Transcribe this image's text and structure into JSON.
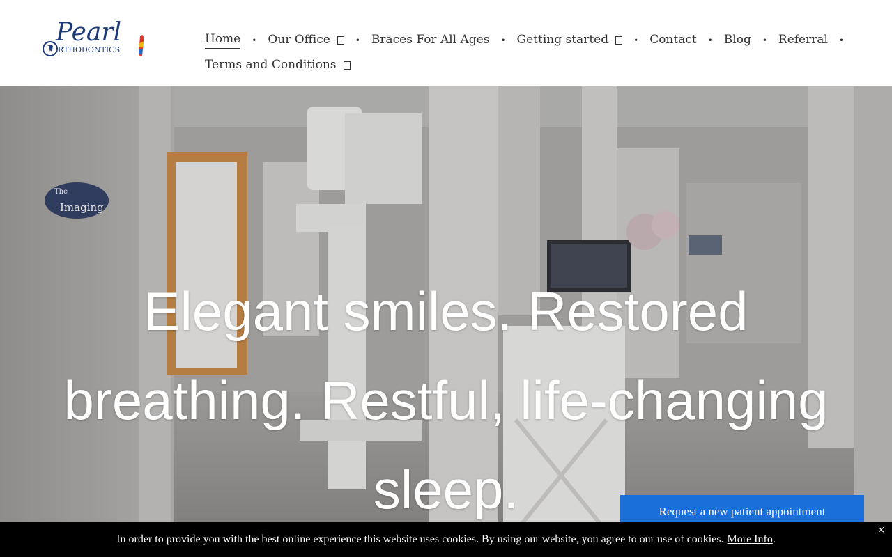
{
  "brand": {
    "logo_script": "Pearl",
    "logo_sub": "RTHODONTICS"
  },
  "nav": {
    "row1": [
      {
        "label": "Home",
        "active": true,
        "dropdown": false
      },
      {
        "label": "Our Office",
        "active": false,
        "dropdown": true
      },
      {
        "label": "Braces For All Ages",
        "active": false,
        "dropdown": false
      },
      {
        "label": "Getting started",
        "active": false,
        "dropdown": true
      },
      {
        "label": "Contact",
        "active": false,
        "dropdown": false
      },
      {
        "label": "Blog",
        "active": false,
        "dropdown": false
      },
      {
        "label": "Referral",
        "active": false,
        "dropdown": false
      }
    ],
    "row2": [
      {
        "label": "Terms and Conditions",
        "active": false,
        "dropdown": true
      }
    ],
    "separator": "•"
  },
  "hero": {
    "title": "Elegant smiles. Restored breathing. Restful, life-changing sleep.",
    "sign_top": "The",
    "sign_main": "Imaging"
  },
  "cta": {
    "label": "Request a new patient appointment"
  },
  "cookie": {
    "message": "In order to provide you with the best online experience this website uses cookies. By using our website, you agree to our use of cookies.",
    "link": "More Info",
    "period": ".",
    "close": "×"
  },
  "colors": {
    "accent": "#1a6fd8",
    "logo_navy": "#1d3a78",
    "cookie_bg": "#000000"
  },
  "icons": {
    "dropdown": "chevron-down-icon",
    "close": "close-icon"
  }
}
